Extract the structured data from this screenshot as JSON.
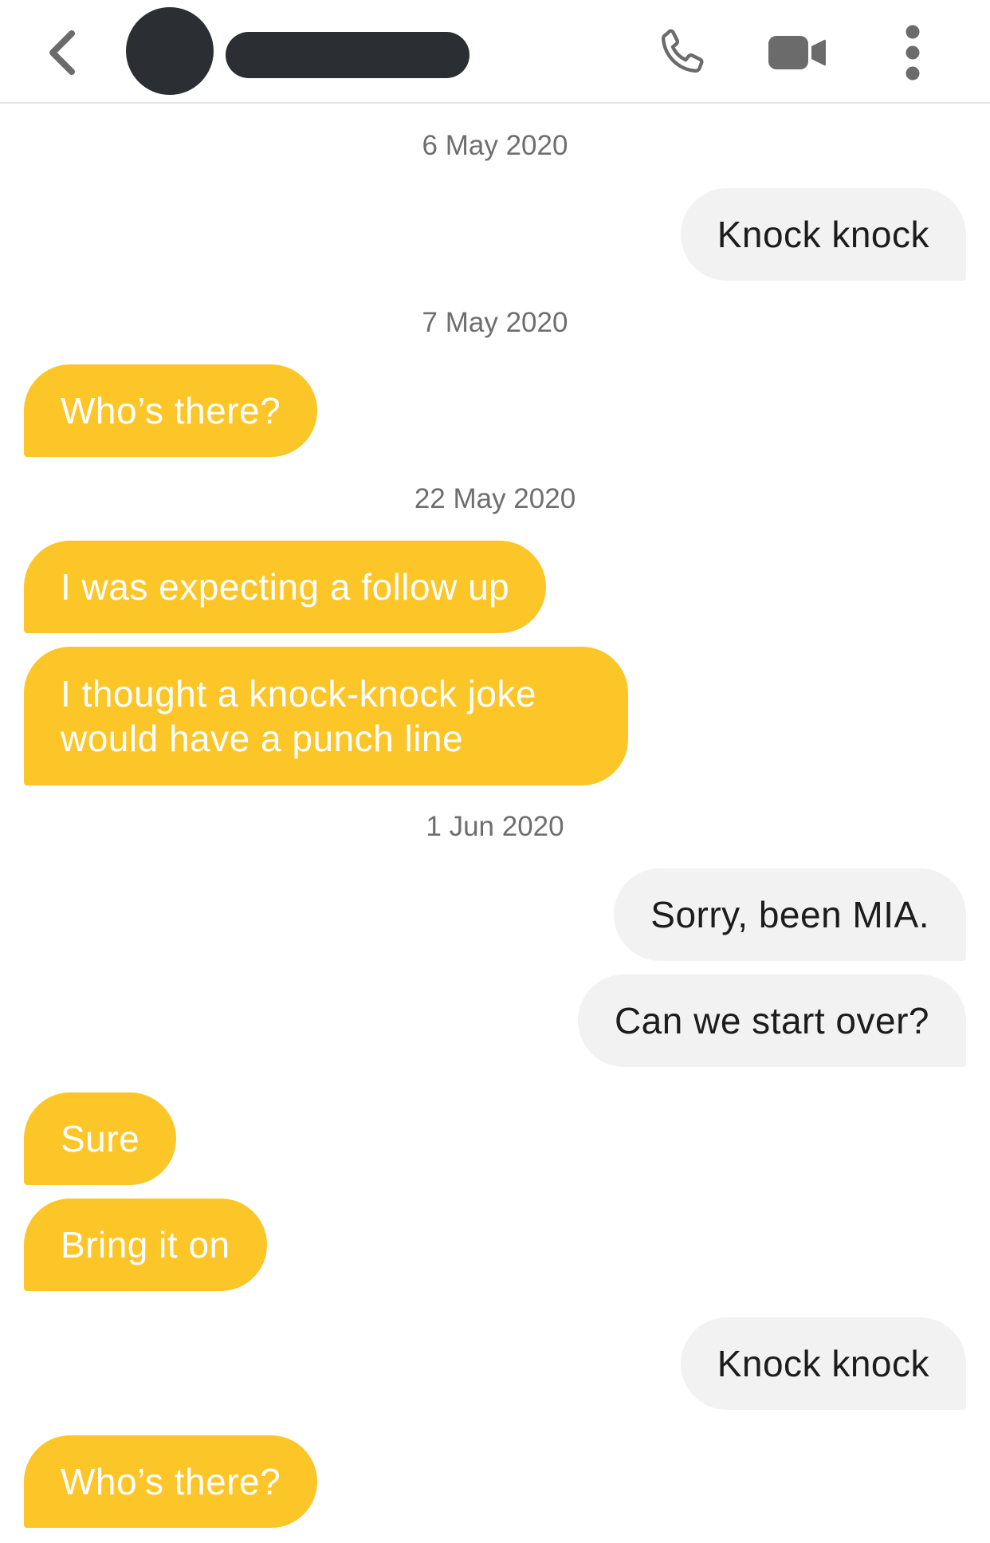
{
  "header": {
    "back_icon": "chevron-left-icon",
    "avatar": "avatar",
    "name_redacted": "redacted-name",
    "phone_icon": "phone-icon",
    "video_icon": "video-camera-icon",
    "more_icon": "more-vertical-icon"
  },
  "colors": {
    "incoming_bubble": "#fcc628",
    "incoming_text": "#ffffff",
    "outgoing_bubble": "#f2f2f2",
    "outgoing_text": "#1c1c1c",
    "date_text": "#6e6e6e",
    "icon": "#6b6b6b",
    "redaction": "#2b2f33"
  },
  "conversation": {
    "date_1": "6 May 2020",
    "msg_1": "Knock knock",
    "date_2": "7 May 2020",
    "msg_2": "Who’s there?",
    "date_3": "22 May 2020",
    "msg_3": "I was expecting a follow up",
    "msg_4": "I thought a knock-knock joke would have a punch line",
    "date_4": "1 Jun 2020",
    "msg_5": "Sorry, been MIA.",
    "msg_6": "Can we start over?",
    "msg_7": "Sure",
    "msg_8": "Bring it on",
    "msg_9": "Knock knock",
    "msg_10": "Who’s there?"
  }
}
